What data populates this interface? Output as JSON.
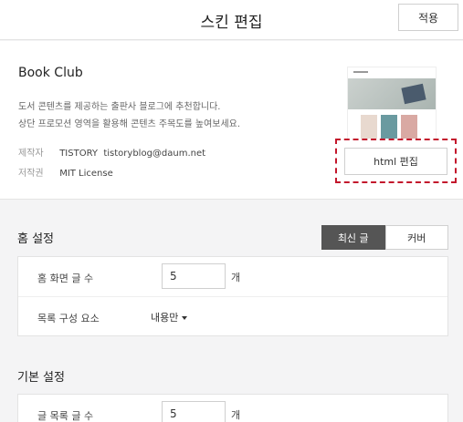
{
  "header": {
    "title": "스킨 편집",
    "apply_label": "적용"
  },
  "skin": {
    "name": "Book Club",
    "desc_line1": "도서 콘텐츠를 제공하는 출판사 블로그에 추천합니다.",
    "desc_line2": "상단 프로모션 영역을 활용해 콘텐츠 주목도를 높여보세요.",
    "creator_label": "제작자",
    "creator_value": "TISTORY  tistoryblog@daum.net",
    "license_label": "저작권",
    "license_value": "MIT License",
    "html_edit_label": "html 편집"
  },
  "home_settings": {
    "title": "홈 설정",
    "tab_latest": "최신 글",
    "tab_cover": "커버",
    "post_count_label": "홈 화면 글 수",
    "post_count_value": "5",
    "post_count_unit": "개",
    "list_style_label": "목록 구성 요소",
    "list_style_value": "내용만"
  },
  "basic_settings": {
    "title": "기본 설정",
    "list_count_label": "글 목록 글 수",
    "list_count_value": "5",
    "list_count_unit": "개"
  },
  "colors": {
    "accent_border": "#c3172c",
    "active_tab": "#555555"
  }
}
